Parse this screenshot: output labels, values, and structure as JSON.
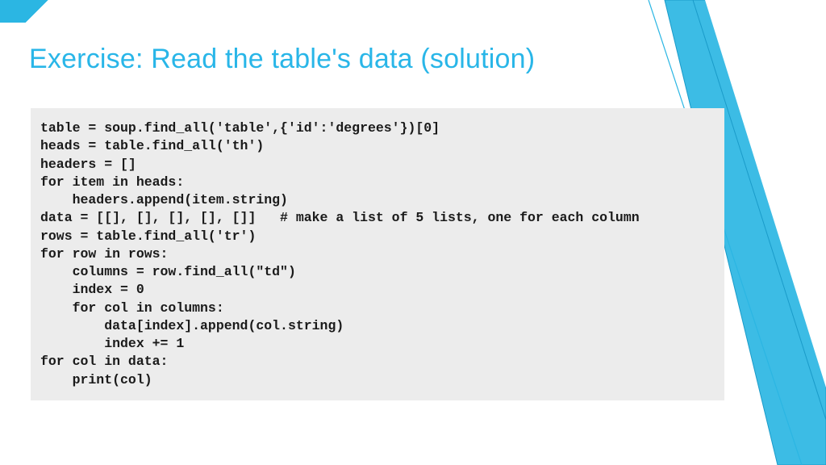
{
  "slide": {
    "title": "Exercise: Read the table's data (solution)",
    "code": "table = soup.find_all('table',{'id':'degrees'})[0]\nheads = table.find_all('th')\nheaders = []\nfor item in heads:\n    headers.append(item.string)\ndata = [[], [], [], [], []]   # make a list of 5 lists, one for each column\nrows = table.find_all('tr')\nfor row in rows:\n    columns = row.find_all(\"td\")\n    index = 0\n    for col in columns:\n        data[index].append(col.string)\n        index += 1\nfor col in data:\n    print(col)"
  }
}
